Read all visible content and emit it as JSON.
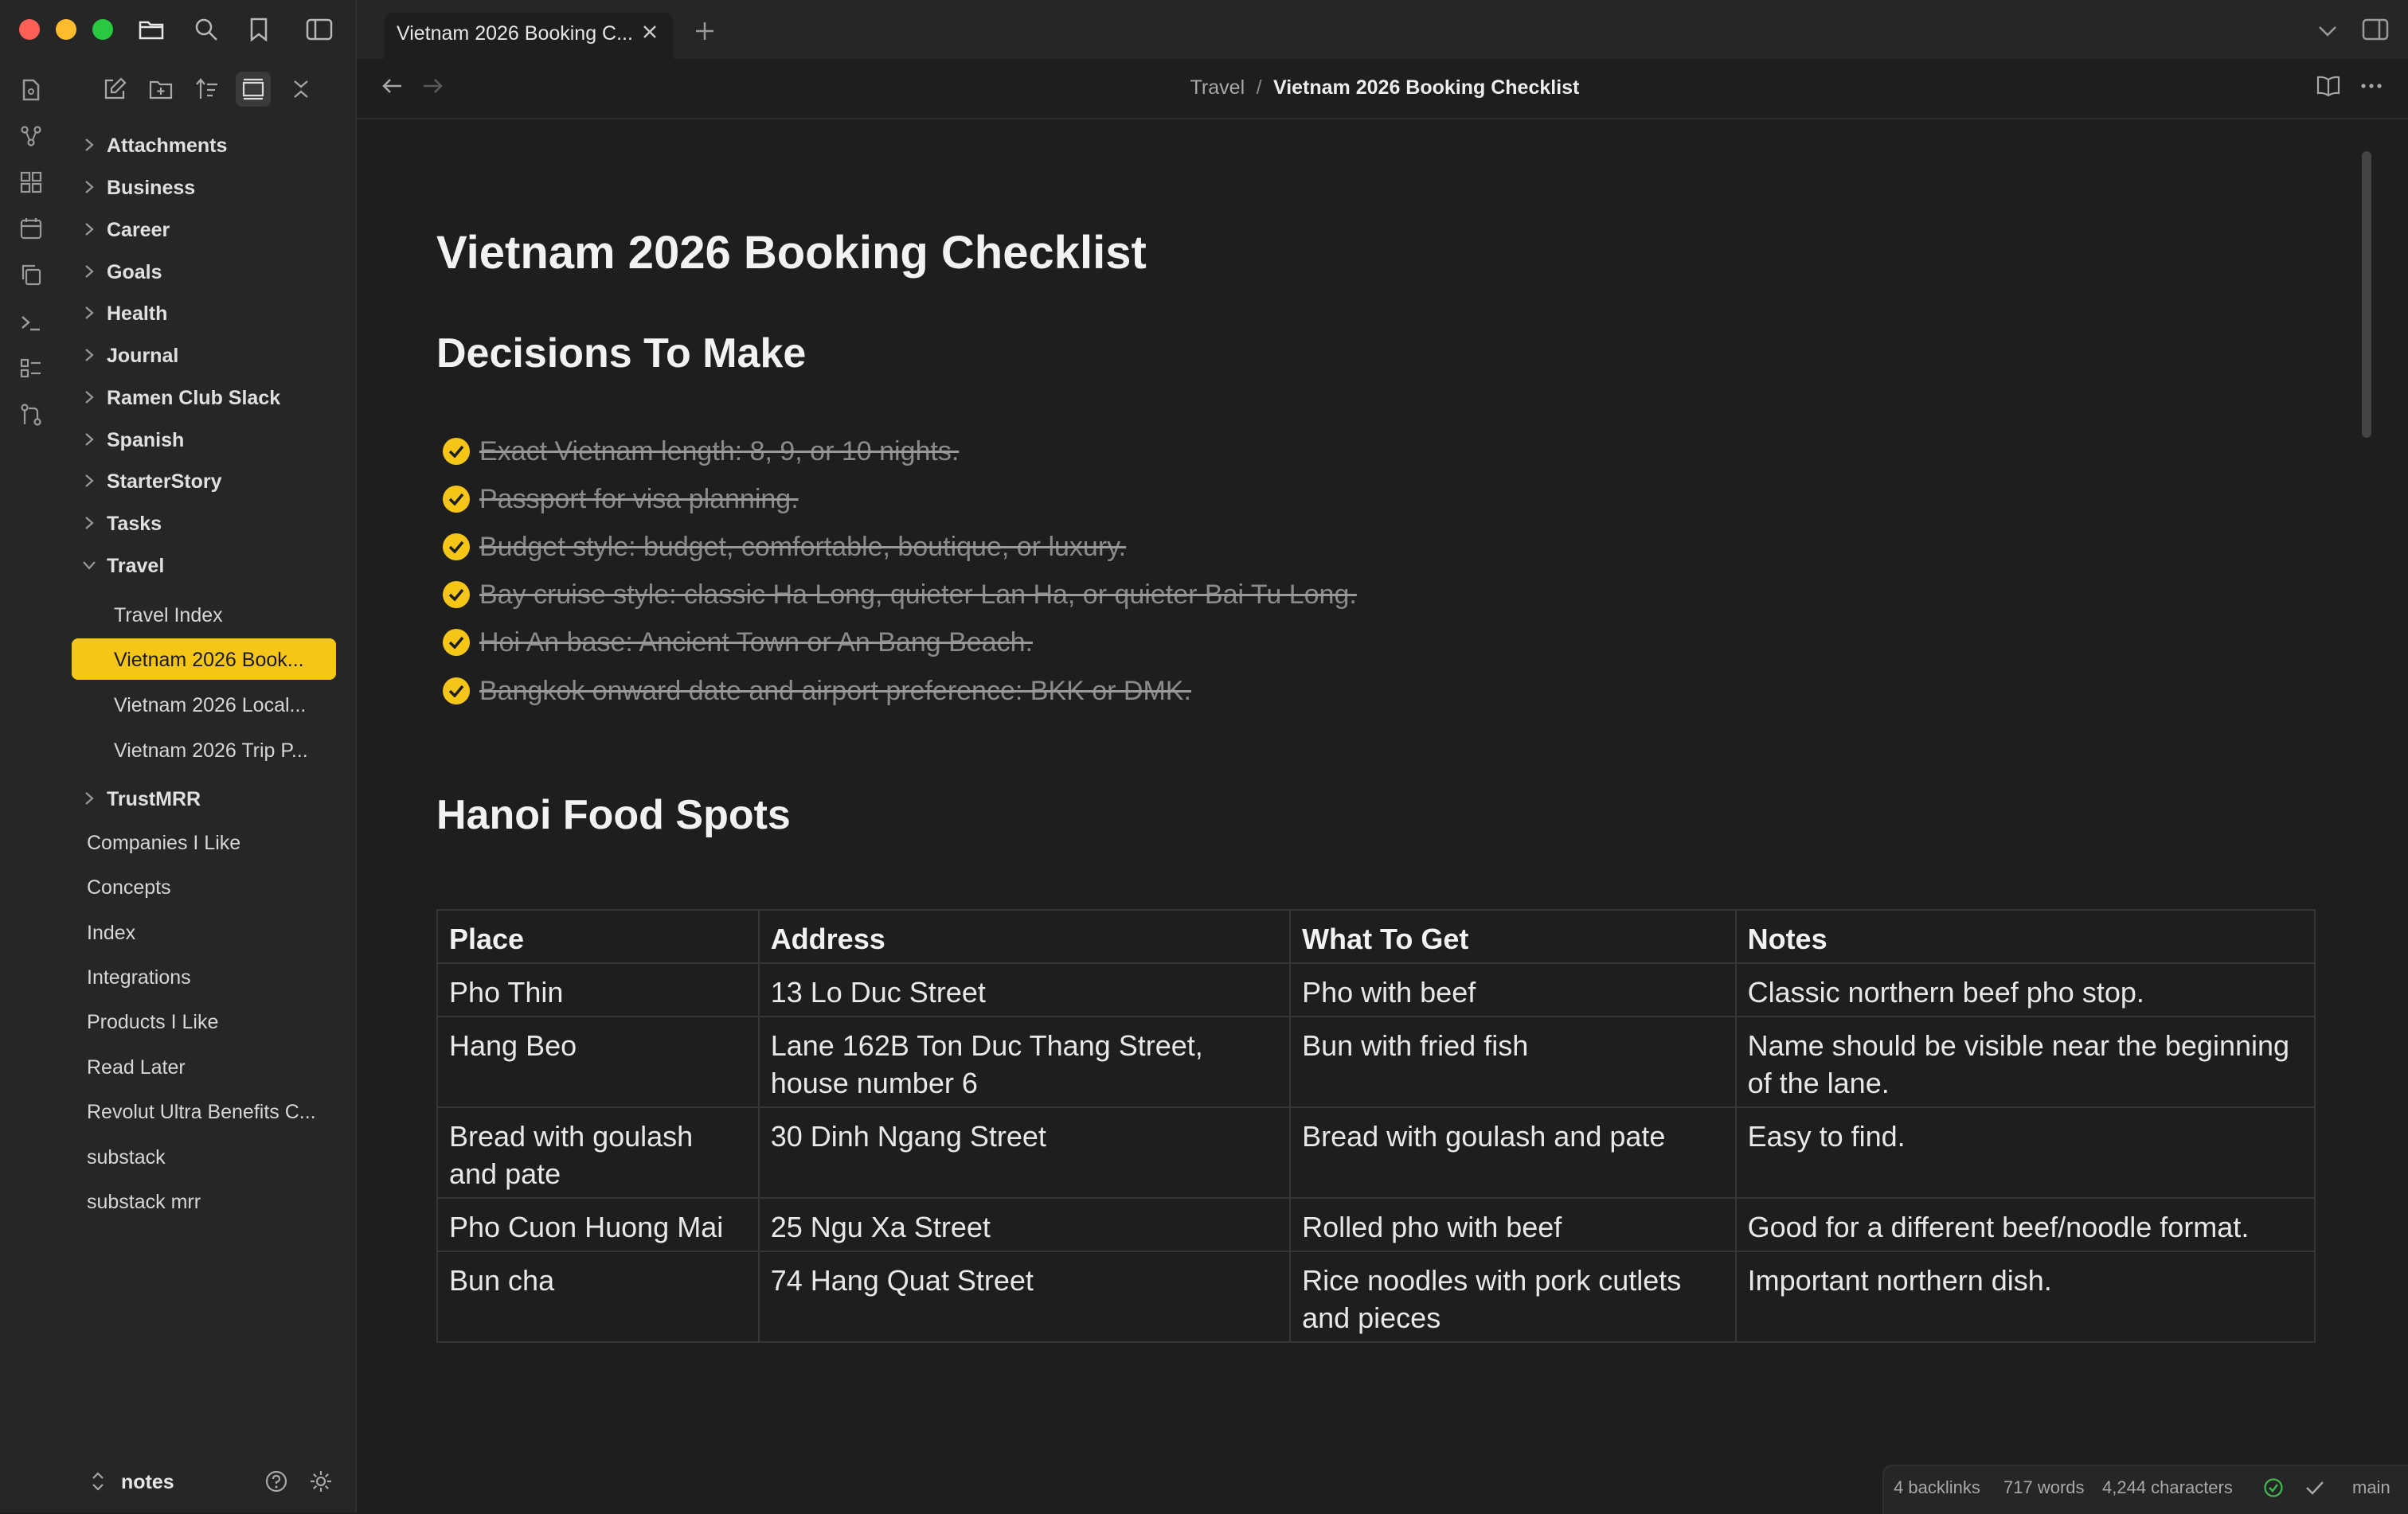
{
  "window": {
    "tab_title": "Vietnam 2026 Booking C...",
    "traffic_colors": [
      "#fe5f57",
      "#febc2e",
      "#28c840"
    ]
  },
  "breadcrumb": {
    "parent": "Travel",
    "separator": "/",
    "current": "Vietnam 2026 Booking Checklist"
  },
  "sidebar": {
    "folders": [
      {
        "label": "Attachments"
      },
      {
        "label": "Business"
      },
      {
        "label": "Career"
      },
      {
        "label": "Goals"
      },
      {
        "label": "Health"
      },
      {
        "label": "Journal"
      },
      {
        "label": "Ramen Club Slack"
      },
      {
        "label": "Spanish"
      },
      {
        "label": "StarterStory"
      },
      {
        "label": "Tasks"
      },
      {
        "label": "Travel"
      }
    ],
    "travel_children": [
      {
        "label": "Travel Index"
      },
      {
        "label": "Vietnam 2026 Book..."
      },
      {
        "label": "Vietnam 2026 Local..."
      },
      {
        "label": "Vietnam 2026 Trip P..."
      }
    ],
    "after_folders": [
      {
        "label": "TrustMRR"
      }
    ],
    "root_files": [
      {
        "label": "Companies I Like"
      },
      {
        "label": "Concepts"
      },
      {
        "label": "Index"
      },
      {
        "label": "Integrations"
      },
      {
        "label": "Products I Like"
      },
      {
        "label": "Read Later"
      },
      {
        "label": "Revolut Ultra Benefits C..."
      },
      {
        "label": "substack"
      },
      {
        "label": "substack mrr"
      }
    ],
    "vault_name": "notes"
  },
  "note": {
    "title": "Vietnam 2026 Booking Checklist",
    "section1": "Decisions To Make",
    "todos": [
      "Exact Vietnam length: 8, 9, or 10 nights.",
      "Passport for visa planning.",
      "Budget style: budget, comfortable, boutique, or luxury.",
      "Bay cruise style: classic Ha Long, quieter Lan Ha, or quieter Bai Tu Long.",
      "Hoi An base: Ancient Town or An Bang Beach.",
      "Bangkok onward date and airport preference: BKK or DMK."
    ],
    "section2": "Hanoi Food Spots",
    "table": {
      "headers": [
        "Place",
        "Address",
        "What To Get",
        "Notes"
      ],
      "rows": [
        [
          "Pho Thin",
          "13 Lo Duc Street",
          "Pho with beef",
          "Classic northern beef pho stop."
        ],
        [
          "Hang Beo",
          "Lane 162B Ton Duc Thang Street, house number 6",
          "Bun with fried fish",
          "Name should be visible near the beginning of the lane."
        ],
        [
          "Bread with goulash and pate",
          "30 Dinh Ngang Street",
          "Bread with goulash and pate",
          "Easy to find."
        ],
        [
          "Pho Cuon Huong Mai",
          "25 Ngu Xa Street",
          "Rolled pho with beef",
          "Good for a different beef/noodle format."
        ],
        [
          "Bun cha",
          "74 Hang Quat Street",
          "Rice noodles with pork cutlets and pieces",
          "Important northern dish."
        ]
      ]
    }
  },
  "status": {
    "backlinks": "4 backlinks",
    "words": "717 words",
    "characters": "4,244 characters",
    "branch": "main"
  },
  "colors": {
    "accent": "#f5c518",
    "background": "#1e1e1e",
    "sidebar": "#262626"
  }
}
